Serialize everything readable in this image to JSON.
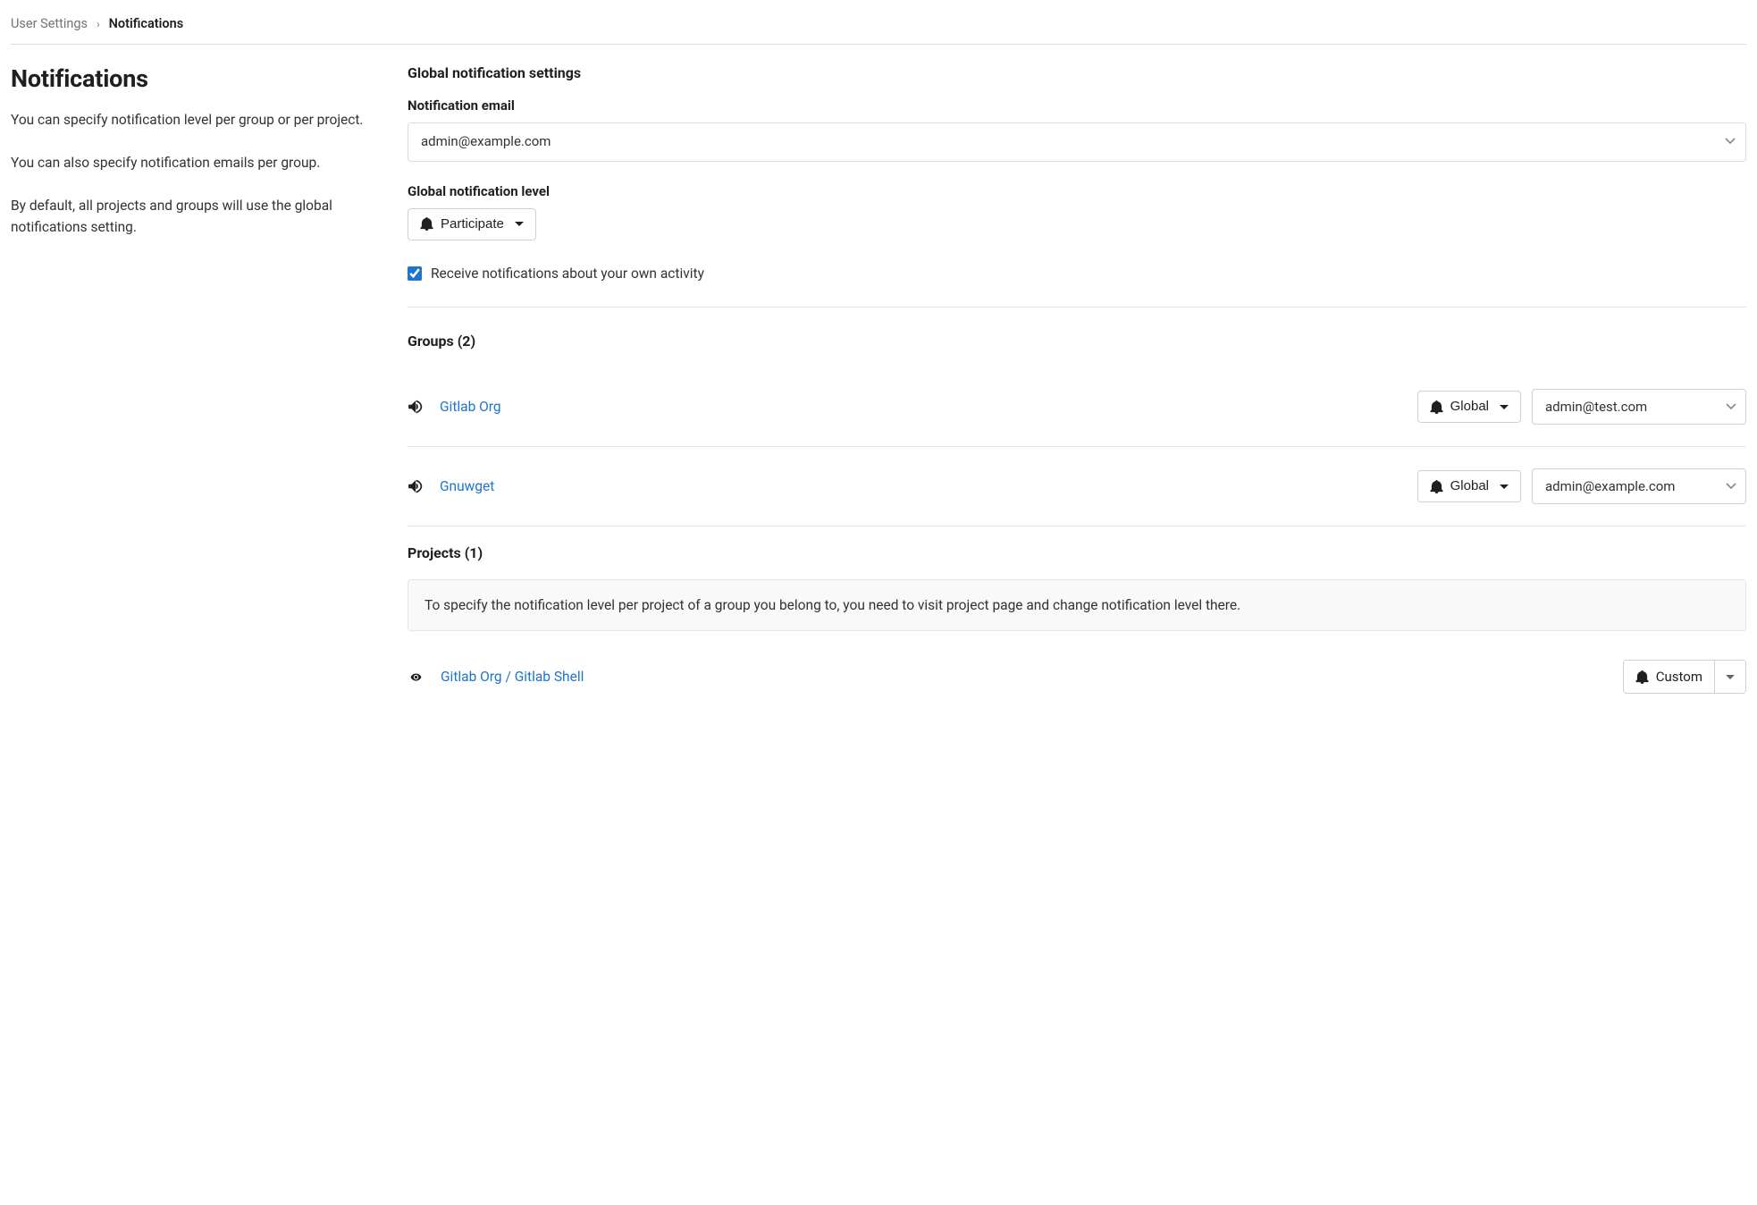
{
  "breadcrumb": {
    "parent": "User Settings",
    "current": "Notifications"
  },
  "sidebar": {
    "title": "Notifications",
    "para1": "You can specify notification level per group or per project.",
    "para2": "You can also specify notification emails per group.",
    "para3": "By default, all projects and groups will use the global notifications setting."
  },
  "global": {
    "heading": "Global notification settings",
    "email_label": "Notification email",
    "email_value": "admin@example.com",
    "level_label": "Global notification level",
    "level_value": "Participate",
    "own_activity_checked": true,
    "own_activity_label": "Receive notifications about your own activity"
  },
  "groups": {
    "heading": "Groups (2)",
    "items": [
      {
        "name": "Gitlab Org",
        "level": "Global",
        "email": "admin@test.com"
      },
      {
        "name": "Gnuwget",
        "level": "Global",
        "email": "admin@example.com"
      }
    ]
  },
  "projects": {
    "heading": "Projects (1)",
    "info": "To specify the notification level per project of a group you belong to, you need to visit project page and change notification level there.",
    "items": [
      {
        "name": "Gitlab Org / Gitlab Shell",
        "level": "Custom"
      }
    ]
  }
}
